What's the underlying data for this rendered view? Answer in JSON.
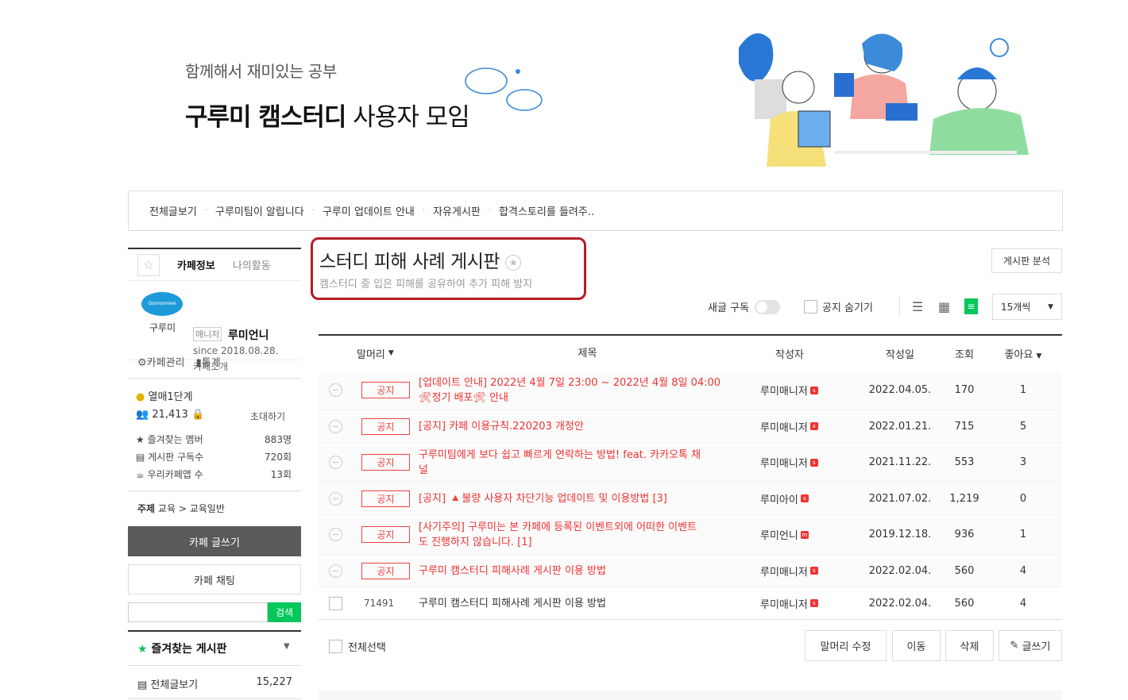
{
  "header": {
    "subtitle": "함께해서 재미있는 공부",
    "title_bold": "구루미 캠스터디",
    "title_rest": " 사용자 모임"
  },
  "top_menu": [
    "전체글보기",
    "구루미팀이 알립니다",
    "구루미 업데이트 안내",
    "자유게시판",
    "합격스토리를 들려주.."
  ],
  "sidebar": {
    "tab_info": "카페정보",
    "tab_activity": "나의활동",
    "logo_text": "Gooroomee",
    "cafe_label": "구루미",
    "manager_badge": "매니저",
    "manager_name": "루미언니",
    "since": "since 2018.08.28.",
    "cafe_intro": "카페소개",
    "admin": "카페관리",
    "stats": "통계",
    "level": "열매1단계",
    "members": "21,413",
    "invite": "초대하기",
    "fav_members_label": "즐겨찾는 멤버",
    "fav_members_val": "883명",
    "board_sub_label": "게시판 구독수",
    "board_sub_val": "720회",
    "app_label": "우리카페앱 수",
    "app_val": "13회",
    "topic_label": "주제",
    "topic_cat": "교육",
    "topic_sub": "교육일반",
    "write_btn": "카페 글쓰기",
    "chat_btn": "카페 채팅",
    "search_btn": "검색",
    "fav_board": "즐겨찾는 게시판",
    "all_posts": "전체글보기",
    "all_posts_count": "15,227"
  },
  "board": {
    "title": "스터디 피해 사례 게시판",
    "desc": "캠스터디 중 입은 피해를 공유하여 추가 피해 방지",
    "analysis_btn": "게시판 분석",
    "subscribe": "새글 구독",
    "hide_notice": "공지 숨기기",
    "per_page": "15개씩"
  },
  "table": {
    "headers": {
      "prefix": "말머리",
      "title": "제목",
      "author": "작성자",
      "date": "작성일",
      "views": "조회",
      "likes": "좋아요"
    },
    "notice_badge": "공지",
    "rows": [
      {
        "title1": "[업데이트 안내] ",
        "title2": "2022년 4월 7일 23:00 ~ 2022년 4월 8일 04:00",
        "title3": "🛠정기 배포🛠 안내",
        "author": "루미매니저",
        "date": "2022.04.05.",
        "views": "170",
        "likes": "1"
      },
      {
        "title1": "[공지] ",
        "title2": "카페 이용규칙.220203 개정안",
        "title3": "",
        "author": "루미매니저",
        "date": "2022.01.21.",
        "views": "715",
        "likes": "5"
      },
      {
        "title1": "",
        "title2": "구루미팀에게 보다 쉽고 빠르게 연락하는 방법! feat. 카카오톡 채",
        "title3": "널",
        "author": "루미매니저",
        "date": "2021.11.22.",
        "views": "553",
        "likes": "3"
      },
      {
        "title1": "[공지] ",
        "title2": "🔺불량 사용자 차단기능 업데이트 및 이용방법 [3]",
        "title3": "",
        "author": "루미아이",
        "date": "2021.07.02.",
        "views": "1,219",
        "likes": "0"
      },
      {
        "title1": "[사기주의] ",
        "title2": "구루미는 본 카페에 등록된 이벤트외에 어떠한 이벤트",
        "title3": "도 진행하지 않습니다. [1]",
        "author": "루미언니",
        "date": "2019.12.18.",
        "views": "936",
        "likes": "1"
      },
      {
        "title1": "",
        "title2": "구루미 캠스터디 피해사례 게시판 이용 방법",
        "title3": "",
        "author": "루미매니저",
        "date": "2022.02.04.",
        "views": "560",
        "likes": "4"
      }
    ],
    "normal_row": {
      "num": "71491",
      "title": "구루미 캠스터디 피해사례 게시판 이용 방법",
      "author": "루미매니저",
      "date": "2022.02.04.",
      "views": "560",
      "likes": "4"
    }
  },
  "footer": {
    "select_all": "전체선택",
    "edit_prefix": "말머리 수정",
    "move": "이동",
    "delete": "삭제",
    "write": "글쓰기"
  },
  "colors": {
    "accent_red": "#e33333",
    "highlight_box": "#b31d24",
    "write_btn": "#5a5a5a",
    "search_green": "#03c75a"
  }
}
